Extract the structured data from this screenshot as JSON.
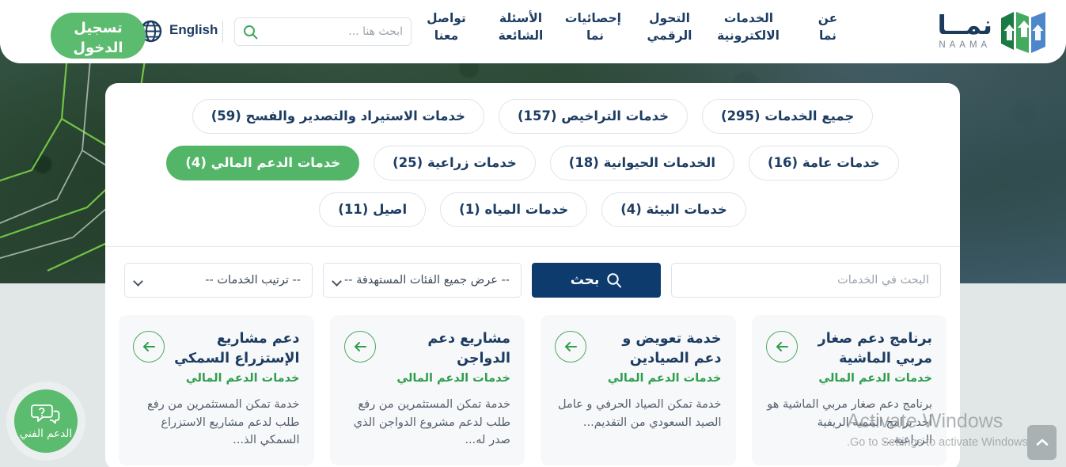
{
  "header": {
    "logo": {
      "arabic": "نمــا",
      "latin": "NAAMA",
      "icon": "naama-logo-icon"
    },
    "nav": [
      {
        "label": "عن\nنما"
      },
      {
        "label": "الخدمات\nالالكترونية"
      },
      {
        "label": "التحول\nالرقمي"
      },
      {
        "label": "إحصائيات\nنما"
      },
      {
        "label": "الأسئلة\nالشائعة"
      },
      {
        "label": "تواصل\nمعنا"
      }
    ],
    "search": {
      "placeholder": "ابحث هنا ...",
      "value": "",
      "icon": "search-icon"
    },
    "language": {
      "label": "English",
      "icon": "globe-icon"
    },
    "login_label": "تسجيل\nالدخول"
  },
  "filters": {
    "chips": [
      {
        "label": "جميع الخدمات (295)",
        "active": false
      },
      {
        "label": "خدمات التراخيص (157)",
        "active": false
      },
      {
        "label": "خدمات الاستيراد والتصدير والفسح (59)",
        "active": false
      },
      {
        "label": "خدمات عامة (16)",
        "active": false
      },
      {
        "label": "الخدمات الحيوانية (18)",
        "active": false
      },
      {
        "label": "خدمات زراعية (25)",
        "active": false
      },
      {
        "label": "خدمات الدعم المالي (4)",
        "active": true
      },
      {
        "label": "خدمات البيئة (4)",
        "active": false
      },
      {
        "label": "خدمات المياه (1)",
        "active": false
      },
      {
        "label": "اصيل (11)",
        "active": false
      }
    ],
    "service_search": {
      "placeholder": "البحث في الخدمات",
      "value": ""
    },
    "search_button": {
      "label": "بحث",
      "icon": "search-icon"
    },
    "category_select": {
      "value": "-- عرض جميع الفئات المستهدفة --"
    },
    "sort_select": {
      "value": "-- ترتيب الخدمات --"
    }
  },
  "cards": [
    {
      "title": "برنامج دعم صغار مربي الماشية",
      "category": "خدمات الدعم المالي",
      "description": "برنامج دعم صغار مربي الماشية هو أحد برامج التنمية الريفية الزراعية...",
      "icon": "arrow-left-circle-icon"
    },
    {
      "title": "خدمة تعويض و دعم الصيادين",
      "category": "خدمات الدعم المالي",
      "description": "خدمة تمكن الصياد الحرفي و عامل الصيد السعودي من التقديم...",
      "icon": "arrow-left-circle-icon"
    },
    {
      "title": "مشاريع دعم الدواجن",
      "category": "خدمات الدعم المالي",
      "description": "خدمة تمكن المستثمرين من رفع طلب لدعم مشروع الدواجن الذي صدر له...",
      "icon": "arrow-left-circle-icon"
    },
    {
      "title": "دعم مشاريع الإستزراع السمكي",
      "category": "خدمات الدعم المالي",
      "description": "خدمة تمكن المستثمرين من رفع طلب لدعم مشاريع الاستزراع السمكي الذ...",
      "icon": "arrow-left-circle-icon"
    }
  ],
  "support": {
    "label": "الدعم الفني",
    "icon": "chat-question-icon"
  },
  "watermark": {
    "title": "Activate Windows",
    "subtitle": "Go to Settings to activate Windows."
  },
  "scroll_top": {
    "icon": "chevron-up-icon"
  },
  "colors": {
    "brand_navy": "#1d3c62",
    "brand_green": "#52b567",
    "search_button": "#0d3b6e",
    "category_green": "#2e9e4f"
  }
}
